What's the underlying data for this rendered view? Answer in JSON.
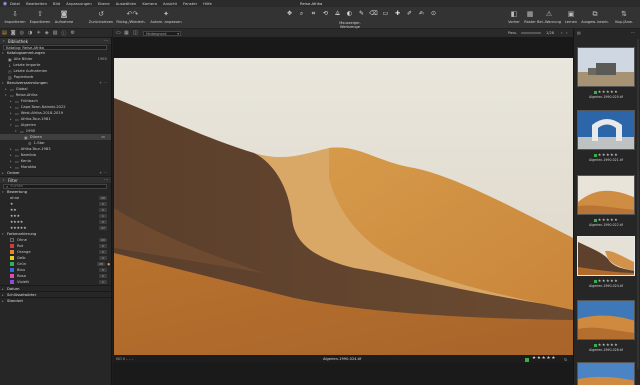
{
  "menubar": {
    "items": [
      "Datei",
      "Bearbeiten",
      "Bild",
      "Anpassungen",
      "Ebene",
      "Auswählen",
      "Kamera",
      "Ansicht",
      "Fenster",
      "Hilfe"
    ],
    "window_title": "Reise-Afrika"
  },
  "toolbar": {
    "left": [
      {
        "label": "Importieren",
        "icon": "import-icon"
      },
      {
        "label": "Exportieren",
        "icon": "export-icon"
      },
      {
        "label": "Aufnahme",
        "icon": "camera-icon"
      },
      {
        "label": "Zurücksetzen",
        "icon": "reset-icon"
      },
      {
        "label": "Rückg./Wiederh.",
        "icon": "undo-icon"
      },
      {
        "label": "Autom. anpassen",
        "icon": "auto-adjust-icon"
      }
    ],
    "center_caption": "Mauszeiger-Werkzeuge",
    "right": [
      {
        "label": "Vorher",
        "icon": "before-icon"
      },
      {
        "label": "Raster",
        "icon": "grid-icon"
      },
      {
        "label": "Bel.-Warnung",
        "icon": "exposure-warning-icon"
      },
      {
        "label": "Lernen",
        "icon": "learn-icon"
      },
      {
        "label": "Ausgew. bearb.",
        "icon": "edit-selected-icon"
      },
      {
        "label": "Kop./Anw.",
        "icon": "copy-apply-icon"
      }
    ]
  },
  "viewer": {
    "background_select": "Hintergrund",
    "fit_label": "Pass.",
    "page_counter": "1/28",
    "status_left": "ISO 0  –  –  –",
    "filename": "Algerien-1990-024.tif",
    "rating": "★★★★★",
    "color_tag": "#38b04a"
  },
  "library": {
    "header": "Bibliothek",
    "catalog": "Katalog: Reise-Afrika",
    "catalog_collections_header": "Katalogsammlungen",
    "catalog_collections": [
      {
        "label": "Alle Bilder",
        "count": "1965"
      },
      {
        "label": "Letzte Importe",
        "count": ""
      },
      {
        "label": "Letzte Aufnahmen",
        "count": ""
      },
      {
        "label": "Papierkorb",
        "count": ""
      }
    ],
    "user_collections_header": "Benutzersammlungen",
    "tree": [
      {
        "label": "Global",
        "level": 0
      },
      {
        "label": "Reise-Afrika",
        "level": 0
      },
      {
        "label": "Frühbach",
        "level": 1
      },
      {
        "label": "Cape-Town-Nairobi-2022",
        "level": 1
      },
      {
        "label": "West-Afrika-2018-2019",
        "level": 1
      },
      {
        "label": "Afrika-Tour-1981",
        "level": 1
      },
      {
        "label": "Algerien",
        "level": 1
      },
      {
        "label": "1990",
        "level": 2
      },
      {
        "label": "Dünen",
        "level": 3,
        "count": "28",
        "selected": true
      },
      {
        "label": "1-Star",
        "level": 3
      },
      {
        "label": "Afrika-Tour-1983",
        "level": 1
      },
      {
        "label": "Namibia",
        "level": 1
      },
      {
        "label": "Kenia",
        "level": 1
      },
      {
        "label": "Marokko",
        "level": 1
      }
    ],
    "folders_label": "Ordner"
  },
  "filter": {
    "header": "Filter",
    "search_placeholder": "Suchen",
    "rating_header": "Bewertung",
    "ratings": [
      {
        "label": "ohne",
        "count": "20"
      },
      {
        "label": "★",
        "count": "0"
      },
      {
        "label": "★★",
        "count": "0"
      },
      {
        "label": "★★★",
        "count": "1"
      },
      {
        "label": "★★★★",
        "count": "0"
      },
      {
        "label": "★★★★★",
        "count": "27"
      }
    ],
    "colortag_header": "Farbmarkierung",
    "colortags": [
      {
        "label": "Ohne",
        "count": "20",
        "color": "#2a2a2a"
      },
      {
        "label": "Rot",
        "count": "0",
        "color": "#d63b3b"
      },
      {
        "label": "Orange",
        "count": "0",
        "color": "#e8862a"
      },
      {
        "label": "Gelb",
        "count": "0",
        "color": "#e6cf2d"
      },
      {
        "label": "Grün",
        "count": "28",
        "color": "#38b04a"
      },
      {
        "label": "Blau",
        "count": "0",
        "color": "#2f6fe0"
      },
      {
        "label": "Rosa",
        "count": "0",
        "color": "#e048b8"
      },
      {
        "label": "Violett",
        "count": "1",
        "color": "#8a4fd6"
      }
    ],
    "date_label": "Datum",
    "keywords_label": "Schlüsselwörter",
    "location_label": "Standort"
  },
  "filmstrip": {
    "thumbs": [
      {
        "caption": "Algerien-1990-020.tif",
        "rating": "★★★★★"
      },
      {
        "caption": "Algerien-1990-021.tif",
        "rating": "★★★★★"
      },
      {
        "caption": "Algerien-1990-022.tif",
        "rating": "★★★★★"
      },
      {
        "caption": "Algerien-1990-024.tif",
        "rating": "★★★★★"
      },
      {
        "caption": "Algerien-1990-026.tif",
        "rating": "★★★★★"
      }
    ]
  }
}
